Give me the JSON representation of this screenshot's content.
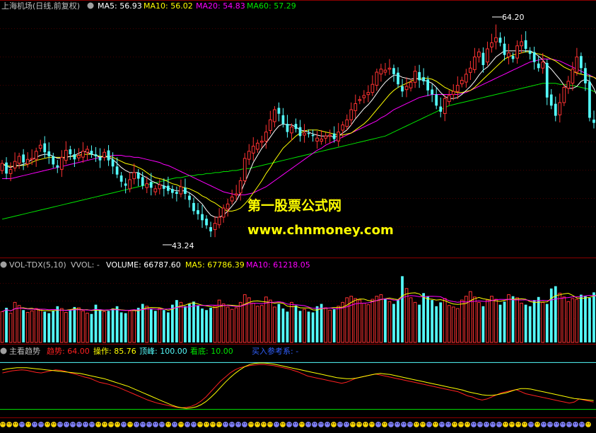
{
  "header": {
    "stock_name": "上海机场(日线,前复权)",
    "ma5": "MA5: 56.93",
    "ma10": "MA10: 56.02",
    "ma20": "MA20: 54.83",
    "ma60": "MA60: 57.29"
  },
  "annotations": {
    "high_label": "64.20",
    "low_label": "43.24"
  },
  "watermark": {
    "line1": "第一股票公式网",
    "line2": "www.chnmoney.com"
  },
  "volume_header": {
    "name": "VOL-TDX(5,10)",
    "vvol": "VVOL: -",
    "volume": "VOLUME: 66787.60",
    "ma5": "MA5: 67786.39",
    "ma10": "MA10: 61218.05"
  },
  "indicator_header": {
    "name": "主看趋势",
    "trend": "趋势: 64.00",
    "operate": "操作: 85.76",
    "peak": "顶峰: 100.00",
    "bottom": "看底: 10.00",
    "buy_ref": "买入参考系: -"
  },
  "colors": {
    "up": "#ff3232",
    "down": "#54fcfc",
    "ma5": "#ffffff",
    "ma10": "#ffff00",
    "ma20": "#ff00ff",
    "ma60": "#00e600",
    "grid": "#8b0000",
    "watermark": "#ffff00",
    "trend_line": "#ff2020",
    "operate_line": "#ffff00",
    "peak_line": "#54fcfc",
    "bottom_line": "#00e600",
    "buy_ref": "#3060ff"
  },
  "chart_data": [
    {
      "type": "candlestick",
      "title": "上海机场(日线,前复权)",
      "ylim": [
        41.5,
        65.5
      ],
      "high": 64.2,
      "low": 43.24,
      "legend": [
        "MA5: 56.93",
        "MA10: 56.02",
        "MA20: 54.83",
        "MA60: 57.29"
      ],
      "close": [
        50.5,
        49.5,
        49.9,
        50.7,
        51.2,
        50.6,
        50.9,
        51.0,
        51.7,
        52.3,
        51.6,
        51.2,
        50.4,
        50.1,
        51.1,
        51.8,
        51.4,
        50.9,
        51.3,
        51.7,
        51.9,
        51.4,
        51.2,
        50.8,
        51.6,
        50.8,
        50.2,
        49.4,
        48.7,
        48.3,
        48.9,
        49.6,
        49.0,
        48.3,
        48.5,
        48.1,
        48.0,
        48.4,
        48.0,
        47.8,
        47.6,
        47.5,
        48.2,
        47.5,
        46.9,
        45.8,
        45.5,
        44.9,
        44.4,
        43.8,
        44.6,
        45.2,
        46.1,
        46.5,
        47.2,
        47.5,
        48.8,
        51.0,
        51.7,
        52.2,
        52.5,
        52.7,
        53.6,
        54.8,
        55.8,
        55.4,
        54.4,
        53.6,
        54.1,
        53.9,
        53.2,
        53.5,
        53.4,
        53.2,
        53.0,
        52.9,
        53.2,
        53.3,
        52.9,
        53.6,
        54.3,
        54.8,
        55.8,
        56.4,
        56.8,
        57.2,
        57.5,
        58.3,
        59.5,
        59.8,
        59.7,
        59.9,
        59.3,
        58.3,
        57.6,
        58.1,
        58.5,
        59.6,
        58.7,
        58.6,
        57.7,
        57.3,
        56.2,
        55.6,
        56.9,
        57.2,
        57.6,
        58.2,
        58.7,
        59.3,
        59.9,
        61.0,
        61.5,
        60.2,
        61.8,
        62.4,
        62.9,
        62.4,
        61.2,
        61.4,
        60.8,
        62.1,
        62.5,
        61.8,
        61.3,
        60.5,
        59.9,
        60.5,
        57.0,
        56.2,
        55.2,
        56.5,
        58.0,
        58.6,
        59.8,
        61.0,
        59.9,
        58.4,
        55.0,
        54.5
      ],
      "volume": [
        40000,
        45000,
        38000,
        52000,
        48000,
        42000,
        39000,
        41000,
        44000,
        43000,
        40000,
        38000,
        41000,
        47000,
        44000,
        39000,
        42000,
        46000,
        45000,
        41000,
        38000,
        37000,
        49000,
        43000,
        40000,
        41000,
        44000,
        47000,
        39000,
        38000,
        41000,
        42000,
        45000,
        50000,
        47000,
        43000,
        41000,
        44000,
        42000,
        39000,
        49000,
        55000,
        52000,
        47000,
        50000,
        53000,
        48000,
        44000,
        42000,
        45000,
        47000,
        55000,
        50000,
        46000,
        43000,
        45000,
        52000,
        62000,
        58000,
        51000,
        47000,
        48000,
        59000,
        55000,
        46000,
        50000,
        44000,
        40000,
        52000,
        48000,
        41000,
        43000,
        40000,
        39000,
        47000,
        50000,
        45000,
        42000,
        43000,
        47000,
        52000,
        58000,
        60000,
        57000,
        55000,
        51000,
        49000,
        56000,
        60000,
        62000,
        57000,
        53000,
        50000,
        56000,
        86000,
        70000,
        58000,
        52000,
        49000,
        64000,
        60000,
        55000,
        47000,
        52000,
        57000,
        48000,
        46000,
        44000,
        55000,
        60000,
        66000,
        59000,
        52000,
        47000,
        55000,
        60000,
        56000,
        49000,
        53000,
        62000,
        60000,
        58000,
        51000,
        49000,
        47000,
        55000,
        59000,
        52000,
        50000,
        70000,
        73000,
        64000,
        59000,
        53000,
        57000,
        56000,
        62000,
        60000,
        58000,
        65000,
        66788
      ],
      "ma5": [
        50.5,
        50.2,
        50.1,
        50.3,
        50.3,
        50.4,
        50.6,
        50.9,
        51.1,
        51.3,
        51.4,
        51.4,
        51.2,
        51.0,
        51.0,
        51.1,
        51.2,
        51.3,
        51.5,
        51.7,
        51.6,
        51.4,
        51.3,
        51.1,
        51.2,
        51.1,
        50.9,
        50.5,
        50.1,
        49.8,
        49.6,
        49.6,
        49.6,
        49.3,
        49.1,
        48.8,
        48.6,
        48.4,
        48.3,
        48.1,
        47.9,
        47.8,
        47.8,
        47.8,
        47.6,
        47.3,
        46.9,
        46.5,
        45.9,
        45.4,
        45.2,
        45.2,
        45.4,
        45.8,
        46.3,
        46.8,
        47.6,
        48.6,
        49.6,
        50.6,
        51.3,
        52.0,
        52.5,
        53.1,
        53.7,
        54.2,
        54.4,
        54.3,
        54.3,
        54.1,
        53.8,
        53.7,
        53.6,
        53.4,
        53.3,
        53.2,
        53.2,
        53.2,
        53.1,
        53.2,
        53.5,
        53.8,
        54.3,
        54.9,
        55.4,
        55.9,
        56.3,
        56.8,
        57.4,
        58.0,
        58.5,
        58.9,
        59.2,
        59.2,
        59.0,
        58.9,
        58.8,
        58.9,
        58.8,
        58.7,
        58.6,
        58.4,
        58.0,
        57.5,
        57.1,
        56.9,
        56.9,
        57.0,
        57.3,
        57.7,
        58.1,
        58.6,
        59.2,
        59.7,
        60.0,
        60.5,
        61.0,
        61.3,
        61.6,
        61.6,
        61.6,
        61.6,
        61.6,
        61.6,
        61.6,
        61.4,
        61.1,
        60.7,
        60.2,
        59.8,
        59.3,
        58.8,
        58.2,
        57.9,
        57.9,
        58.1,
        58.6,
        58.8,
        58.6,
        57.9,
        56.9
      ],
      "ma10": [
        50.5,
        50.3,
        50.2,
        50.2,
        50.3,
        50.3,
        50.4,
        50.6,
        50.8,
        50.9,
        51.0,
        51.1,
        51.1,
        51.1,
        51.1,
        51.1,
        51.2,
        51.2,
        51.3,
        51.4,
        51.4,
        51.4,
        51.3,
        51.2,
        51.2,
        51.2,
        51.1,
        50.9,
        50.7,
        50.5,
        50.4,
        50.3,
        50.1,
        49.9,
        49.6,
        49.3,
        49.1,
        49.0,
        48.9,
        48.7,
        48.5,
        48.4,
        48.2,
        48.1,
        48.0,
        47.8,
        47.6,
        47.3,
        47.1,
        46.8,
        46.6,
        46.3,
        46.0,
        45.8,
        45.8,
        45.9,
        46.1,
        46.5,
        47.0,
        47.6,
        48.2,
        48.8,
        49.5,
        50.1,
        50.8,
        51.4,
        52.0,
        52.4,
        52.8,
        53.2,
        53.5,
        53.7,
        53.8,
        53.8,
        53.8,
        53.7,
        53.6,
        53.5,
        53.4,
        53.3,
        53.3,
        53.4,
        53.5,
        53.8,
        54.1,
        54.4,
        54.8,
        55.3,
        55.8,
        56.3,
        56.8,
        57.3,
        57.7,
        58.0,
        58.2,
        58.4,
        58.6,
        58.8,
        58.9,
        58.9,
        58.9,
        58.8,
        58.6,
        58.3,
        58.0,
        57.8,
        57.6,
        57.5,
        57.5,
        57.6,
        57.7,
        58.0,
        58.4,
        58.8,
        59.2,
        59.6,
        60.0,
        60.4,
        60.8,
        61.0,
        61.2,
        61.3,
        61.4,
        61.5,
        61.5,
        61.4,
        61.3,
        61.2,
        61.0,
        60.8,
        60.6,
        60.3,
        60.0,
        59.8,
        59.6,
        59.4,
        59.3,
        59.2,
        59.1,
        59.0,
        58.7
      ],
      "ma20": [
        49.0,
        49.0,
        49.0,
        49.1,
        49.2,
        49.3,
        49.4,
        49.5,
        49.6,
        49.7,
        49.8,
        49.9,
        50.0,
        50.1,
        50.2,
        50.3,
        50.4,
        50.5,
        50.6,
        50.7,
        50.8,
        50.9,
        51.0,
        51.1,
        51.2,
        51.2,
        51.3,
        51.3,
        51.3,
        51.2,
        51.2,
        51.1,
        51.1,
        51.0,
        50.9,
        50.8,
        50.7,
        50.6,
        50.4,
        50.3,
        50.1,
        49.9,
        49.7,
        49.5,
        49.3,
        49.1,
        48.9,
        48.7,
        48.5,
        48.3,
        48.1,
        47.9,
        47.7,
        47.6,
        47.5,
        47.4,
        47.4,
        47.4,
        47.5,
        47.6,
        47.8,
        48.0,
        48.2,
        48.5,
        48.8,
        49.1,
        49.4,
        49.7,
        50.0,
        50.3,
        50.6,
        50.9,
        51.2,
        51.5,
        51.8,
        52.0,
        52.3,
        52.5,
        52.7,
        52.9,
        53.1,
        53.3,
        53.5,
        53.7,
        53.9,
        54.1,
        54.3,
        54.5,
        54.7,
        55.0,
        55.2,
        55.5,
        55.8,
        56.0,
        56.2,
        56.4,
        56.6,
        56.8,
        57.0,
        57.1,
        57.2,
        57.3,
        57.3,
        57.3,
        57.3,
        57.3,
        57.3,
        57.3,
        57.4,
        57.5,
        57.7,
        57.9,
        58.1,
        58.3,
        58.5,
        58.7,
        58.9,
        59.1,
        59.3,
        59.5,
        59.7,
        59.9,
        60.1,
        60.3,
        60.5,
        60.6,
        60.7,
        60.8,
        60.8,
        60.8,
        60.7,
        60.6,
        60.4,
        60.2,
        60.0,
        59.8,
        59.6,
        59.4,
        59.2,
        59.0,
        58.8
      ],
      "ma60": [
        45.0,
        45.1,
        45.2,
        45.3,
        45.4,
        45.5,
        45.6,
        45.7,
        45.8,
        45.9,
        46.0,
        46.1,
        46.2,
        46.3,
        46.4,
        46.5,
        46.6,
        46.7,
        46.8,
        46.9,
        47.0,
        47.1,
        47.2,
        47.3,
        47.4,
        47.5,
        47.6,
        47.7,
        47.8,
        47.9,
        48.0,
        48.1,
        48.2,
        48.3,
        48.4,
        48.5,
        48.6,
        48.7,
        48.8,
        48.9,
        49.0,
        49.1,
        49.1,
        49.2,
        49.3,
        49.3,
        49.4,
        49.4,
        49.5,
        49.5,
        49.6,
        49.6,
        49.7,
        49.7,
        49.8,
        49.8,
        49.9,
        50.0,
        50.0,
        50.1,
        50.2,
        50.3,
        50.4,
        50.5,
        50.6,
        50.7,
        50.8,
        50.9,
        51.0,
        51.1,
        51.2,
        51.3,
        51.4,
        51.5,
        51.6,
        51.7,
        51.8,
        51.9,
        52.0,
        52.1,
        52.2,
        52.3,
        52.4,
        52.5,
        52.6,
        52.7,
        52.8,
        52.9,
        53.0,
        53.1,
        53.2,
        53.4,
        53.6,
        53.8,
        54.0,
        54.2,
        54.4,
        54.6,
        54.8,
        55.0,
        55.2,
        55.4,
        55.6,
        55.8,
        56.0,
        56.2,
        56.3,
        56.4,
        56.5,
        56.6,
        56.7,
        56.8,
        56.9,
        57.0,
        57.1,
        57.2,
        57.3,
        57.4,
        57.5,
        57.6,
        57.7,
        57.8,
        57.9,
        58.0,
        58.1,
        58.2,
        58.3,
        58.4,
        58.4,
        58.4,
        58.4,
        58.3,
        58.3,
        58.2,
        58.2,
        58.1,
        58.0,
        57.9,
        57.8,
        57.6,
        57.4,
        57.3
      ]
    },
    {
      "type": "line",
      "title": "主看趋势",
      "ylim": [
        0,
        110
      ],
      "peak": 100,
      "bottom": 10,
      "series": [
        {
          "name": "趋势",
          "values": [
            80,
            82,
            84,
            85,
            86,
            85,
            83,
            81,
            80,
            82,
            84,
            86,
            85,
            83,
            80,
            78,
            75,
            72,
            70,
            66,
            62,
            60,
            58,
            55,
            52,
            48,
            44,
            40,
            36,
            32,
            28,
            25,
            22,
            20,
            18,
            16,
            14,
            13,
            14,
            16,
            20,
            26,
            34,
            44,
            54,
            64,
            72,
            80,
            86,
            90,
            92,
            94,
            95,
            96,
            96,
            95,
            94,
            92,
            90,
            88,
            85,
            82,
            78,
            74,
            72,
            70,
            68,
            66,
            64,
            62,
            60,
            62,
            66,
            70,
            72,
            74,
            76,
            78,
            76,
            74,
            72,
            70,
            68,
            66,
            64,
            62,
            60,
            58,
            56,
            54,
            52,
            50,
            48,
            46,
            44,
            40,
            36,
            34,
            30,
            28,
            30,
            34,
            38,
            42,
            44,
            46,
            48,
            44,
            40,
            38,
            36,
            34,
            32,
            30,
            28,
            26,
            24,
            22,
            24,
            30,
            28,
            26,
            24
          ]
        },
        {
          "name": "操作",
          "values": [
            86,
            88,
            89,
            90,
            90,
            90,
            89,
            88,
            87,
            86,
            85,
            84,
            83,
            82,
            81,
            80,
            79,
            77,
            75,
            73,
            71,
            69,
            66,
            63,
            60,
            57,
            54,
            50,
            46,
            42,
            38,
            34,
            30,
            26,
            22,
            18,
            15,
            13,
            12,
            13,
            15,
            19,
            25,
            33,
            42,
            52,
            62,
            71,
            79,
            86,
            92,
            96,
            98,
            99,
            99,
            98,
            97,
            95,
            93,
            91,
            89,
            87,
            85,
            83,
            81,
            79,
            77,
            75,
            73,
            71,
            70,
            69,
            69,
            70,
            72,
            74,
            76,
            78,
            79,
            78,
            77,
            75,
            73,
            71,
            69,
            67,
            65,
            63,
            61,
            59,
            57,
            55,
            53,
            51,
            49,
            47,
            44,
            42,
            40,
            38,
            37,
            37,
            38,
            40,
            42,
            45,
            48,
            50,
            50,
            49,
            47,
            45,
            43,
            41,
            39,
            37,
            35,
            33,
            31,
            30,
            29,
            28,
            27
          ]
        }
      ]
    }
  ]
}
